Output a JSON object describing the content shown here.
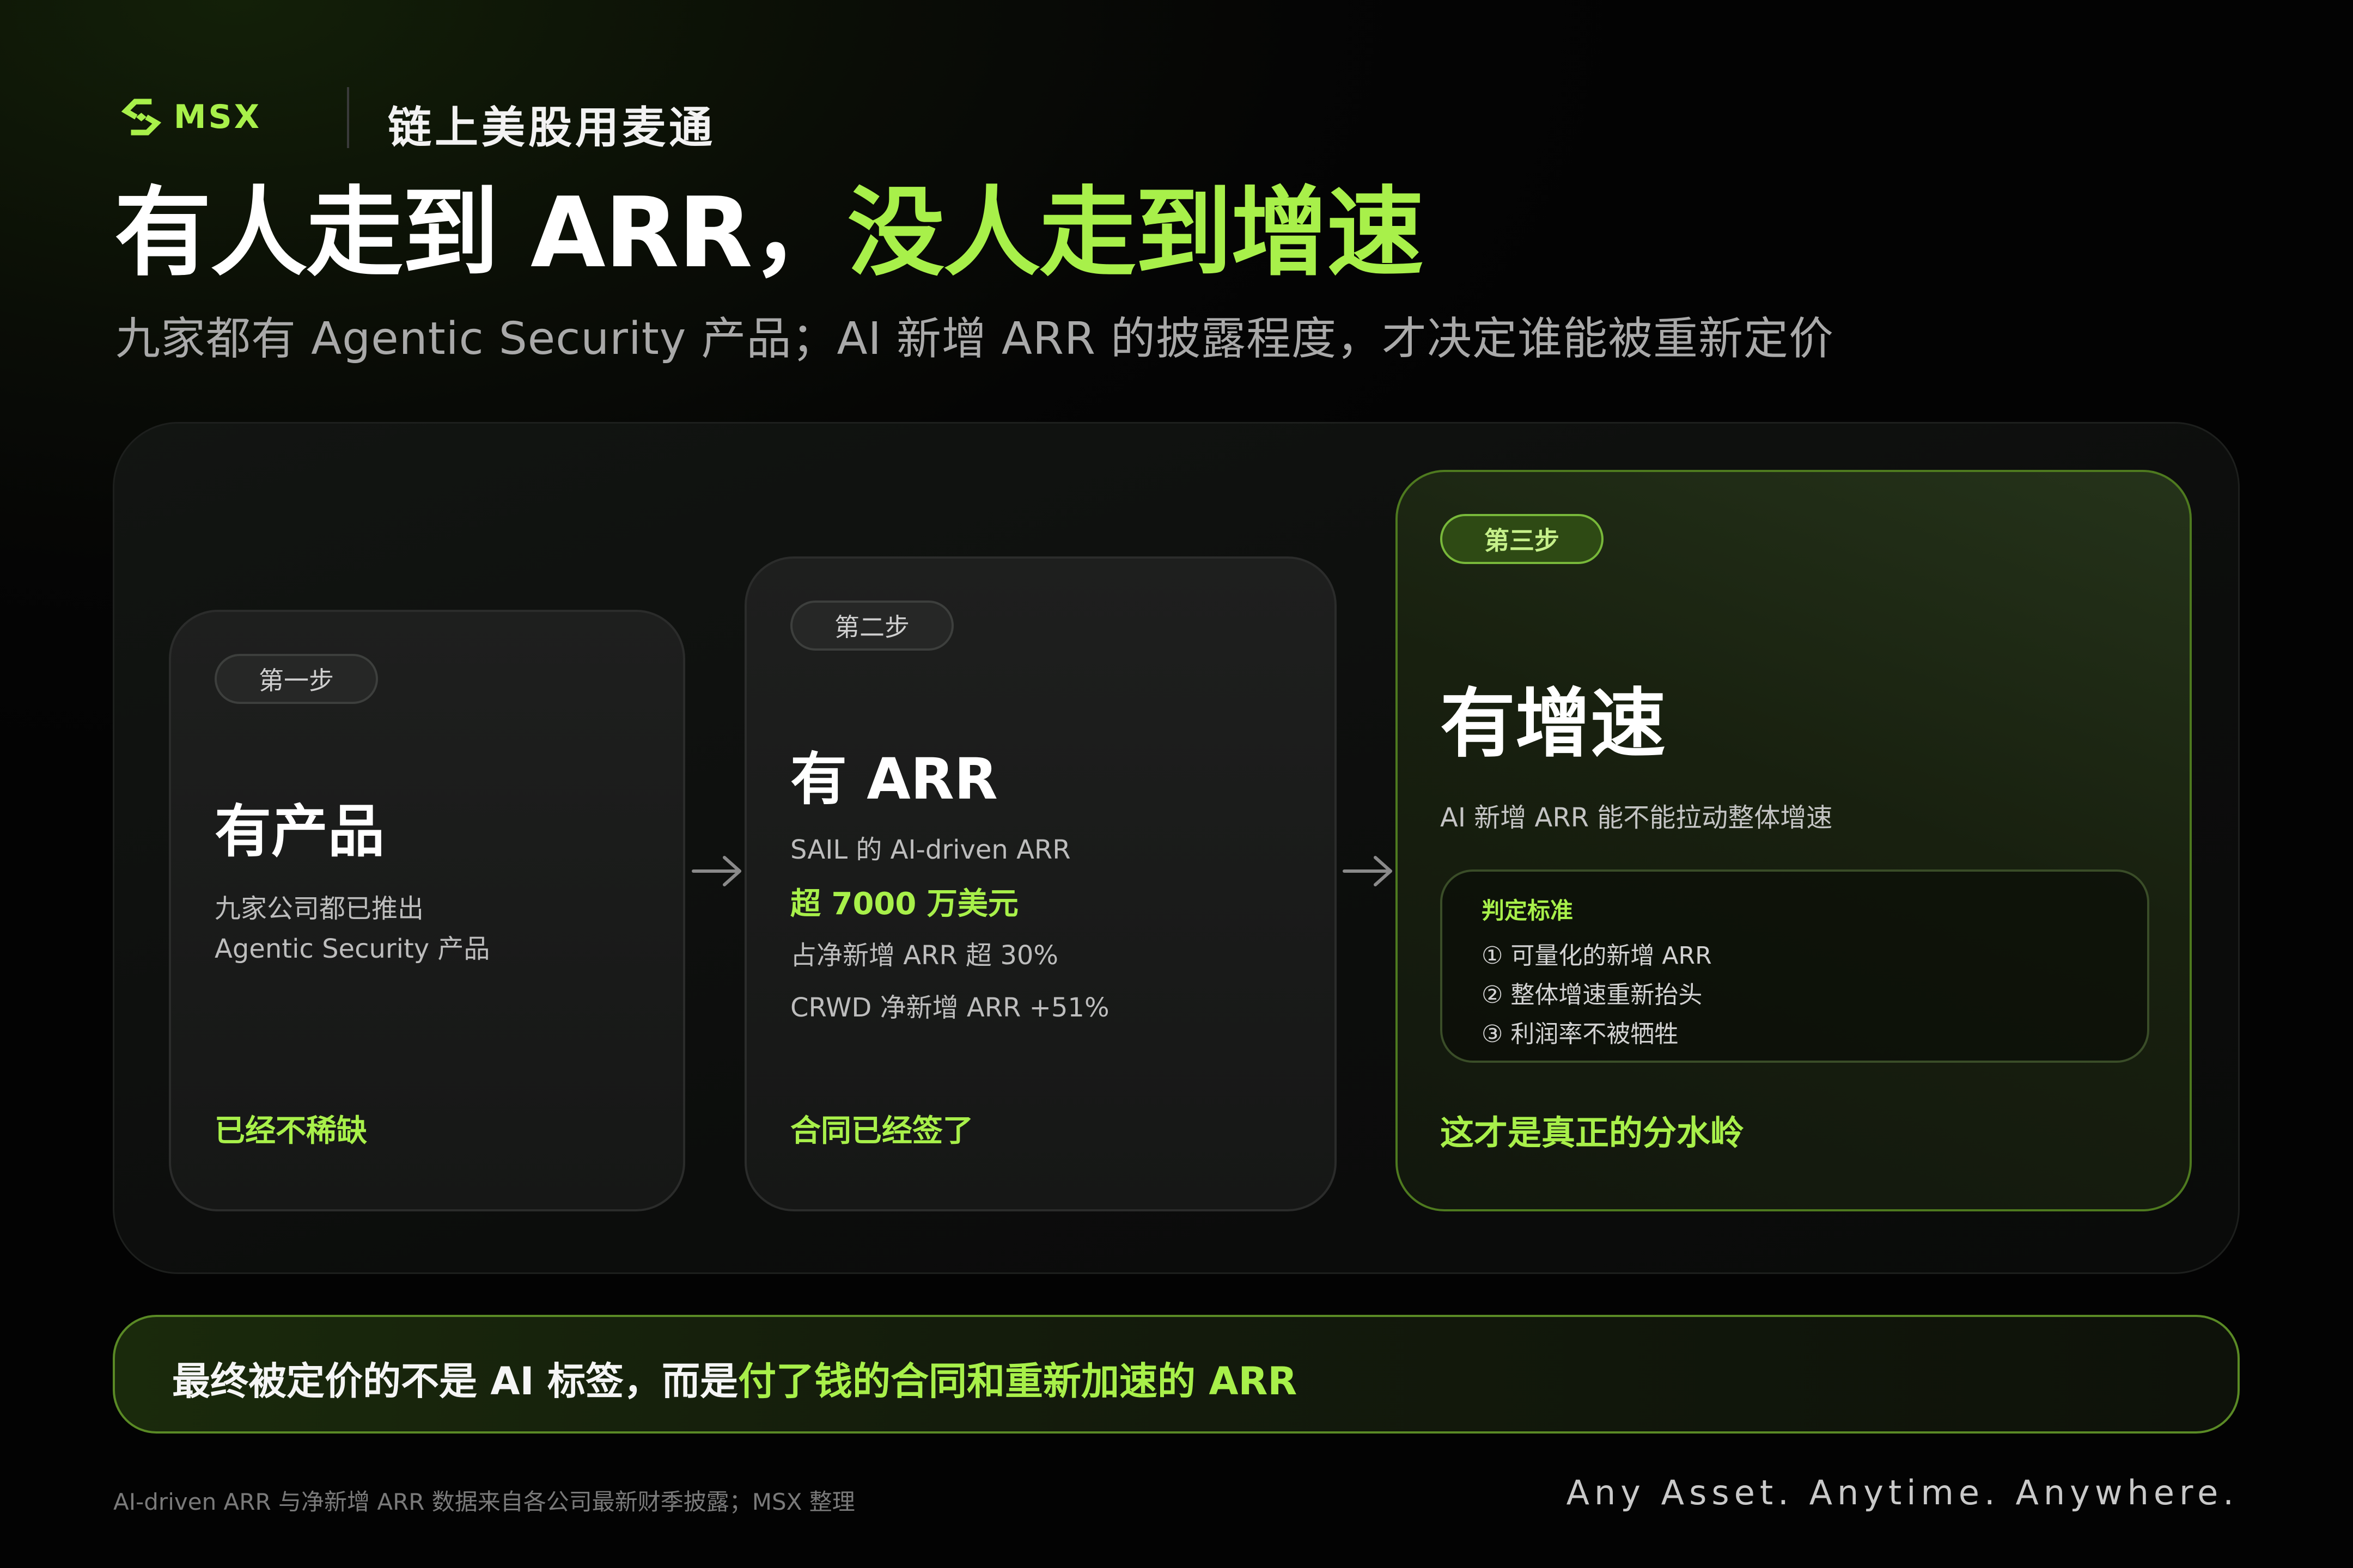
{
  "header": {
    "brand_name": "MSX",
    "tagline": "链上美股用麦通",
    "title_part1": "有人走到 ARR，",
    "title_part2": "没人走到增速",
    "subtitle": "九家都有 Agentic Security 产品；AI 新增 ARR 的披露程度，才决定谁能被重新定价"
  },
  "steps": [
    {
      "badge": "第一步",
      "title": "有产品",
      "lines": [
        "九家公司都已推出",
        "Agentic Security 产品"
      ],
      "footer": "已经不稀缺"
    },
    {
      "badge": "第二步",
      "title": "有 ARR",
      "line1": "SAIL 的 AI-driven ARR",
      "highlight": "超 7000 万美元",
      "line2": "占净新增 ARR 超 30%",
      "line3": "CRWD 净新增 ARR +51%",
      "footer": "合同已经签了"
    },
    {
      "badge": "第三步",
      "title": "有增速",
      "description": "AI 新增 ARR 能不能拉动整体增速",
      "criteria_title": "判定标准",
      "criteria": [
        "① 可量化的新增 ARR",
        "② 整体增速重新抬头",
        "③ 利润率不被牺牲"
      ],
      "footer": "这才是真正的分水岭"
    }
  ],
  "banner": {
    "text_part1": "最终被定价的不是 AI 标签，而是",
    "text_part2": "付了钱的合同和重新加速的 ARR"
  },
  "footer": {
    "footnote": "AI-driven ARR 与净新增 ARR 数据来自各公司最新财季披露；MSX 整理",
    "slogan": "Any Asset. Anytime. Anywhere."
  },
  "colors": {
    "accent": "#a8f04a",
    "background": "#050505"
  },
  "icons": {
    "logo": "msx-logo-icon",
    "arrow": "arrow-right-icon"
  }
}
